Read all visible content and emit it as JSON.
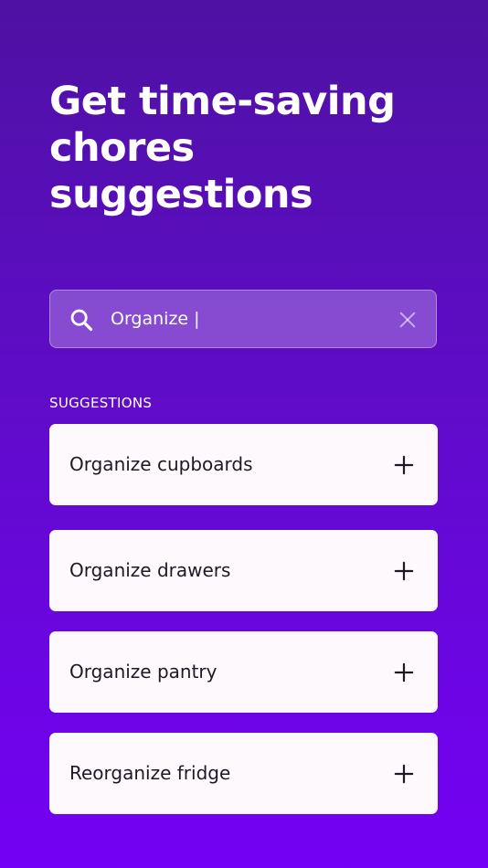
{
  "header": {
    "title": "Get time-saving chores suggestions"
  },
  "search": {
    "value": "Organize |",
    "icon": "search-icon",
    "clear_icon": "close-icon"
  },
  "suggestions": {
    "label": "SUGGESTIONS",
    "items": [
      {
        "label": "Organize cupboards",
        "icon": "plus-icon"
      },
      {
        "label": "Organize drawers",
        "icon": "plus-icon"
      },
      {
        "label": "Organize pantry",
        "icon": "plus-icon"
      },
      {
        "label": "Reorganize fridge",
        "icon": "plus-icon"
      }
    ]
  },
  "colors": {
    "background_top": "#4e11a3",
    "background_bottom": "#7400f5",
    "card_background": "#fdf9fd",
    "text_dark": "#1e1a24",
    "text_light": "#ffffff"
  }
}
